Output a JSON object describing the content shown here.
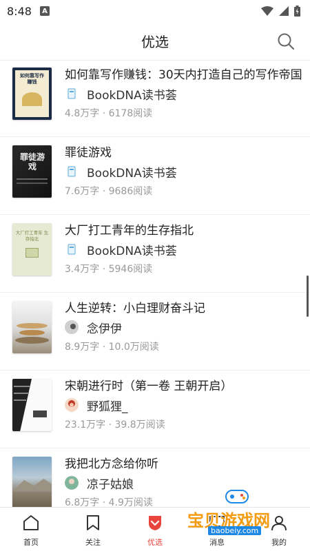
{
  "status_bar": {
    "time": "8:48",
    "notif_glyph": "A"
  },
  "header": {
    "title": "优选"
  },
  "books": [
    {
      "title": "如何靠写作赚钱：30天内打造自己的写作帝国",
      "author": "BookDNA读书荟",
      "stats": "4.8万字 · 6178阅读",
      "cover_text": "如何靠写作赚钱"
    },
    {
      "title": "罪徒游戏",
      "author": "BookDNA读书荟",
      "stats": "7.6万字 · 9686阅读",
      "cover_text": "罪徒游戏"
    },
    {
      "title": "大厂打工青年的生存指北",
      "author": "BookDNA读书荟",
      "stats": "3.4万字 · 5946阅读",
      "cover_text": "大厂打工青年 生存指北"
    },
    {
      "title": "人生逆转：小白理财奋斗记",
      "author": "念伊伊",
      "stats": "8.9万字 · 10.0万阅读",
      "cover_text": ""
    },
    {
      "title": "宋朝进行时（第一卷 王朝开启）",
      "author": "野狐狸_",
      "stats": "23.1万字 · 39.8万阅读",
      "cover_text": ""
    },
    {
      "title": "我把北方念给你听",
      "author": "凉子姑娘",
      "stats": "6.8万字 · 4.9万阅读",
      "cover_text": ""
    }
  ],
  "tabs": [
    {
      "label": "首页",
      "icon": "home-icon"
    },
    {
      "label": "关注",
      "icon": "bookmark-icon"
    },
    {
      "label": "优选",
      "icon": "heart-chevron-icon",
      "active": true
    },
    {
      "label": "消息",
      "icon": "message-icon"
    },
    {
      "label": "我的",
      "icon": "user-icon"
    }
  ],
  "watermark": {
    "text": "宝贝游戏网",
    "url": "baobeiy.com"
  },
  "colors": {
    "accent": "#e8453c"
  }
}
